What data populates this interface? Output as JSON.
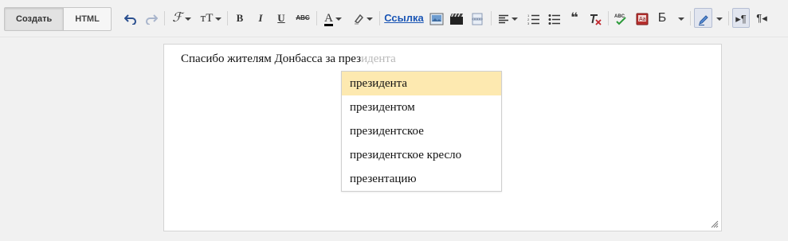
{
  "toolbar": {
    "mode_tabs": [
      {
        "label": "Создать",
        "active": true
      },
      {
        "label": "HTML",
        "active": false
      }
    ],
    "link_label": "Ссылка",
    "font_size_glyph": "тT",
    "bold_glyph": "B",
    "italic_glyph": "I",
    "underline_glyph": "U",
    "strike_glyph": "ABC",
    "text_color_glyph": "A",
    "text_color": "#000000",
    "spell_glyph": "ABC",
    "quote_glyph": "❝",
    "font_glyph": "Б",
    "ltr_glyph": "¶",
    "rtl_glyph": "¶"
  },
  "editor": {
    "typed_text": "Спасибо жителям Донбасса за през",
    "ghost_completion": "идента"
  },
  "suggestions": [
    {
      "label": "президента",
      "selected": true
    },
    {
      "label": "президентом",
      "selected": false
    },
    {
      "label": "президентское",
      "selected": false
    },
    {
      "label": "президентское кресло",
      "selected": false
    },
    {
      "label": "презентацию",
      "selected": false
    }
  ],
  "colors": {
    "suggestion_highlight": "#fde9b0",
    "link_color": "#1b56b5",
    "background": "#f1f1f1"
  }
}
